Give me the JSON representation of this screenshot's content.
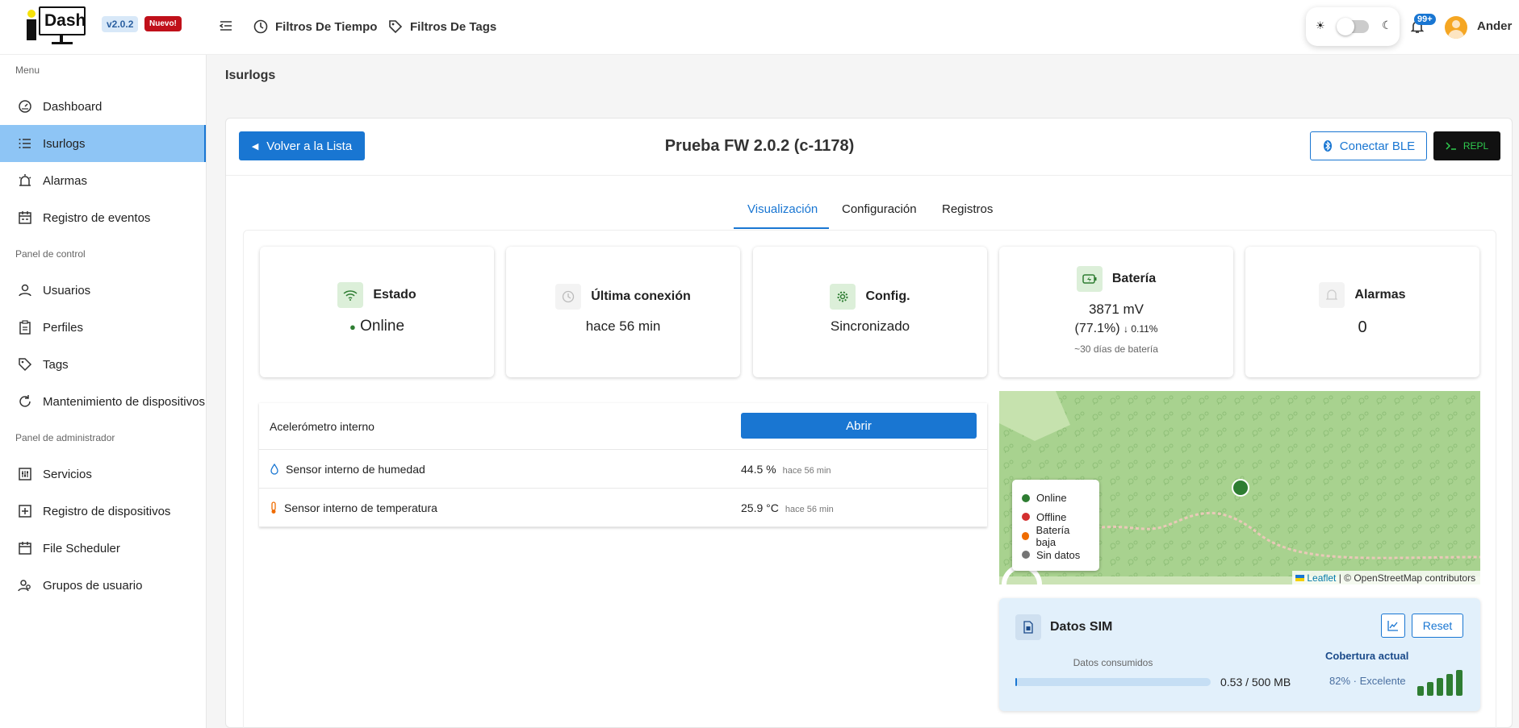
{
  "app": {
    "name": "Dash",
    "version": "v2.0.2",
    "new_badge": "Nuevo!"
  },
  "topbar": {
    "filters_time": "Filtros De Tiempo",
    "filters_tags": "Filtros De Tags",
    "notifications": "99+",
    "user": "Ander",
    "theme_mode": "light"
  },
  "sidebar": {
    "sections": [
      "Menu",
      "Panel de control",
      "Panel de administrador"
    ],
    "menu": [
      {
        "label": "Dashboard",
        "icon": "gauge-icon"
      },
      {
        "label": "Isurlogs",
        "icon": "list-icon",
        "active": true
      },
      {
        "label": "Alarmas",
        "icon": "siren-icon"
      },
      {
        "label": "Registro de eventos",
        "icon": "calendar-log-icon"
      }
    ],
    "control": [
      {
        "label": "Usuarios",
        "icon": "user-icon"
      },
      {
        "label": "Perfiles",
        "icon": "clipboard-icon"
      },
      {
        "label": "Tags",
        "icon": "tag-icon"
      },
      {
        "label": "Mantenimiento de dispositivos",
        "icon": "refresh-icon"
      }
    ],
    "admin": [
      {
        "label": "Servicios",
        "icon": "sliders-icon"
      },
      {
        "label": "Registro de dispositivos",
        "icon": "plus-square-icon"
      },
      {
        "label": "File Scheduler",
        "icon": "calendar-icon"
      },
      {
        "label": "Grupos de usuario",
        "icon": "users-icon"
      }
    ]
  },
  "breadcrumb": "Isurlogs",
  "device": {
    "back": "Volver a la Lista",
    "title": "Prueba FW 2.0.2 (c-1178)",
    "ble": "Conectar BLE",
    "repl": "REPL"
  },
  "tabs": [
    "Visualización",
    "Configuración",
    "Registros"
  ],
  "stats": {
    "estado": {
      "label": "Estado",
      "value": "Online"
    },
    "ultima": {
      "label": "Última conexión",
      "value": "hace 56 min"
    },
    "config": {
      "label": "Config.",
      "value": "Sincronizado"
    },
    "bateria": {
      "label": "Batería",
      "mv": "3871 mV",
      "pct": "(77.1%)",
      "trend": "↓ 0.11%",
      "days": "~30 días de batería"
    },
    "alarmas": {
      "label": "Alarmas",
      "value": "0"
    }
  },
  "sensors": {
    "accel": {
      "label": "Acelerómetro interno",
      "button": "Abrir"
    },
    "humidity": {
      "label": "Sensor interno de humedad",
      "value": "44.5 %",
      "time": "hace 56 min"
    },
    "temperature": {
      "label": "Sensor interno de temperatura",
      "value": "25.9 °C",
      "time": "hace 56 min"
    }
  },
  "map": {
    "legend": [
      {
        "label": "Online",
        "color": "#2e7d32"
      },
      {
        "label": "Offline",
        "color": "#d32f2f"
      },
      {
        "label": "Batería baja",
        "color": "#ef6c00"
      },
      {
        "label": "Sin datos",
        "color": "#757575"
      }
    ],
    "attribution_link": "Leaflet",
    "attribution_text": "| © OpenStreetMap contributors"
  },
  "sim": {
    "title": "Datos SIM",
    "reset": "Reset",
    "used_label": "Datos consumidos",
    "used": "0.53 / 500 MB",
    "used_fraction": 0.00106,
    "coverage_label": "Cobertura actual",
    "coverage_value": "82% · Excelente",
    "coverage_bars": 5
  }
}
